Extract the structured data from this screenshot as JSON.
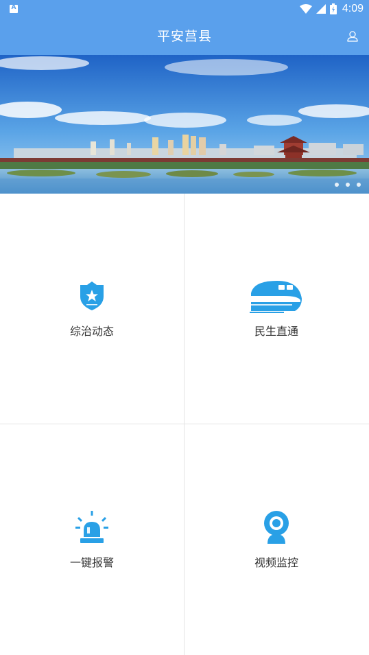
{
  "status_bar": {
    "left_icon": "A",
    "time": "4:09",
    "icons": [
      "wifi-icon",
      "signal-icon",
      "battery-icon"
    ]
  },
  "app_bar": {
    "title": "平安莒县",
    "right_icon": "user-icon"
  },
  "banner": {
    "image": "city-skyline-lake-photo",
    "page_count": 3,
    "active_page": 1
  },
  "tiles": [
    {
      "label": "综治动态",
      "icon": "police-shield-icon"
    },
    {
      "label": "民生直通",
      "icon": "train-icon"
    },
    {
      "label": "一键报警",
      "icon": "alarm-light-icon"
    },
    {
      "label": "视频监控",
      "icon": "webcam-icon"
    }
  ],
  "colors": {
    "primary": "#5aa0ec",
    "icon": "#29a0e6",
    "text": "#333333",
    "divider": "#e3e3e3"
  }
}
